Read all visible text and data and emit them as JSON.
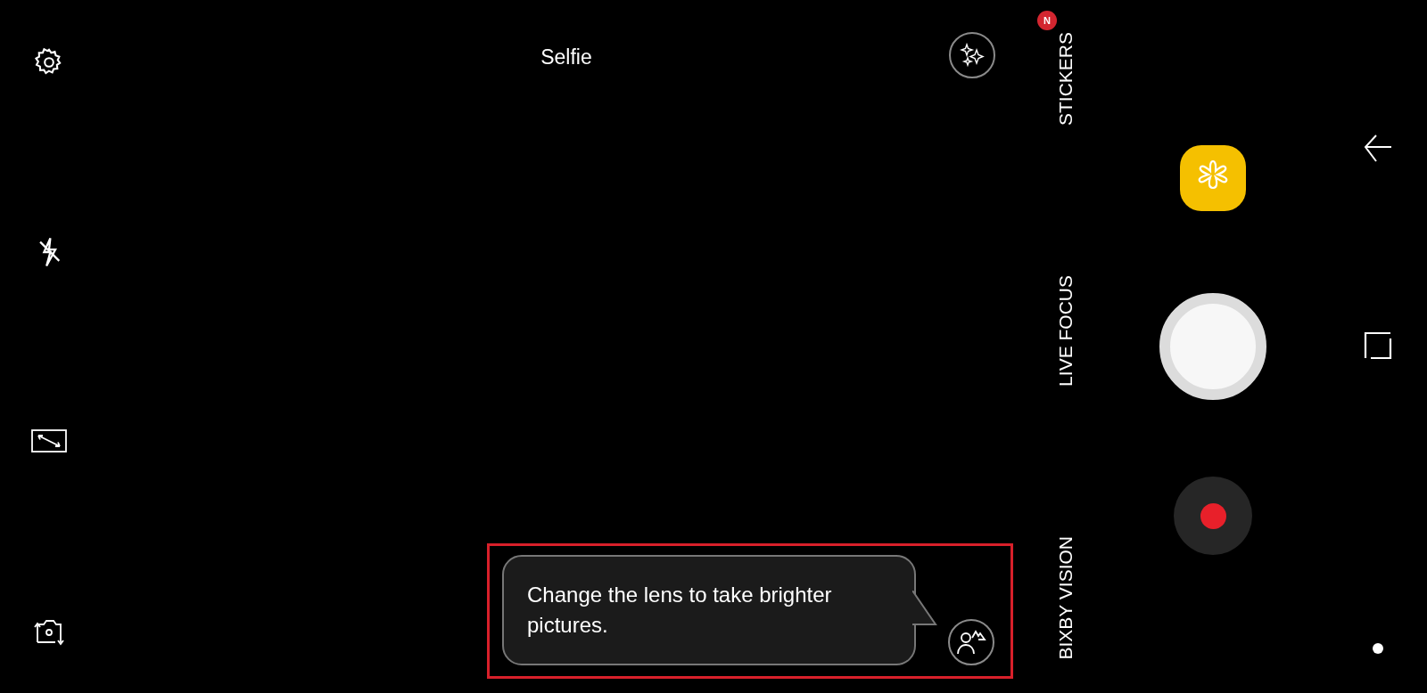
{
  "side_controls": [
    {
      "kind": "settings"
    },
    {
      "kind": "flash_off"
    },
    {
      "kind": "ratio"
    },
    {
      "kind": "switch_camera"
    }
  ],
  "top_bar": {
    "mode_title": "Selfie"
  },
  "tip": {
    "text": "Change the lens to take brighter pictures."
  },
  "modes": [
    {
      "label": "STICKERS",
      "badge": "N"
    },
    {
      "label": "LIVE FOCUS"
    },
    {
      "label": "BIXBY VISION"
    }
  ],
  "nav_bar": [
    {
      "kind": "back"
    },
    {
      "kind": "recents"
    },
    {
      "kind": "home"
    }
  ]
}
